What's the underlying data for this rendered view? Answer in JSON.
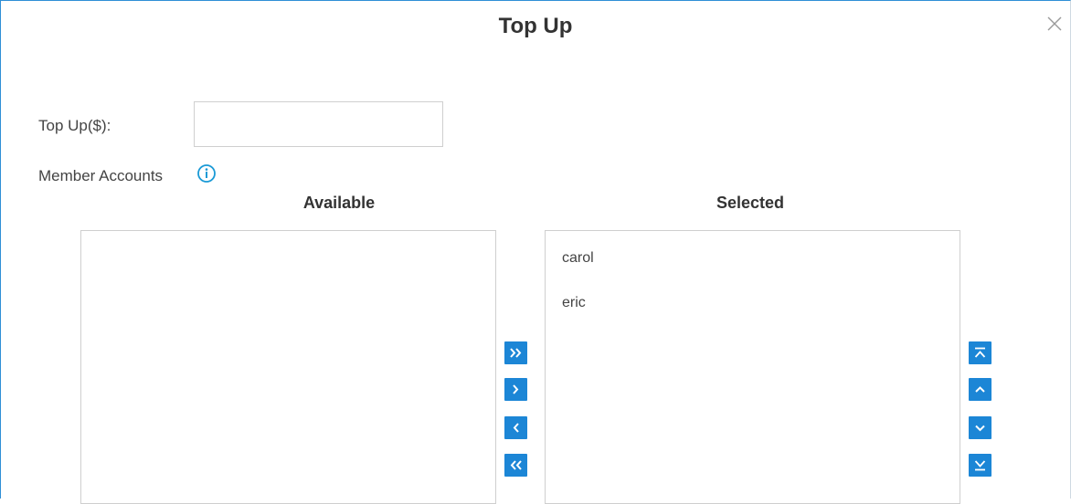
{
  "dialog": {
    "title": "Top Up"
  },
  "form": {
    "topup_label": "Top Up($):",
    "topup_value": "",
    "member_label": "Member Accounts"
  },
  "transfer": {
    "available_heading": "Available",
    "selected_heading": "Selected",
    "available_items": [],
    "selected_items": [
      "carol",
      "eric"
    ]
  },
  "icons": {
    "close": "close-icon",
    "info": "info-icon",
    "move_all_right": "double-chevron-right-icon",
    "move_right": "chevron-right-icon",
    "move_left": "chevron-left-icon",
    "move_all_left": "double-chevron-left-icon",
    "move_top": "move-to-top-icon",
    "move_up": "chevron-up-icon",
    "move_down": "chevron-down-icon",
    "move_bottom": "move-to-bottom-icon"
  },
  "colors": {
    "accent": "#1c86d6",
    "dialog_border": "#2f8fd6",
    "info": "#1a9ad6"
  }
}
